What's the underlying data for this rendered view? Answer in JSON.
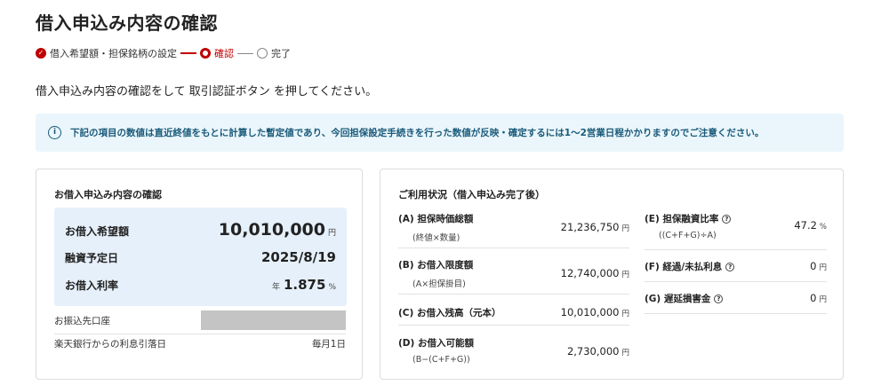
{
  "page_title": "借入申込み内容の確認",
  "steps": [
    {
      "label": "借入希望額・担保銘柄の設定",
      "state": "done"
    },
    {
      "label": "確認",
      "state": "current"
    },
    {
      "label": "完了",
      "state": "todo"
    }
  ],
  "instruction": "借入申込み内容の確認をして 取引認証ボタン を押してください。",
  "notice": {
    "icon": "info-icon",
    "text": "下記の項目の数値は直近終値をもとに計算した暫定値であり、今回担保設定手続きを行った数値が反映・確定するには1〜2営業日程かかりますのでご注意ください。"
  },
  "loan_card": {
    "title": "お借入申込み内容の確認",
    "desired_amount": {
      "label": "お借入希望額",
      "value": "10,010,000",
      "unit": "円"
    },
    "schedule_date": {
      "label": "融資予定日",
      "value": "2025/8/19"
    },
    "interest_rate": {
      "label": "お借入利率",
      "prefix": "年",
      "value": "1.875",
      "unit": "%"
    },
    "deposit_account": {
      "label": "お振込先口座"
    },
    "interest_debit": {
      "label": "楽天銀行からの利息引落日",
      "value": "毎月1日"
    }
  },
  "usage_card": {
    "title": "ご利用状況（借入申込み完了後）",
    "left_items": [
      {
        "label": "(A) 担保時価総額",
        "sub": "(終値×数量)",
        "value": "21,236,750",
        "unit": "円"
      },
      {
        "label": "(B) お借入限度額",
        "sub": "(A×担保掛目)",
        "value": "12,740,000",
        "unit": "円"
      },
      {
        "label": "(C) お借入残高（元本）",
        "sub": "",
        "value": "10,010,000",
        "unit": "円"
      },
      {
        "label": "(D) お借入可能額",
        "sub": "(B−(C+F+G))",
        "value": "2,730,000",
        "unit": "円"
      }
    ],
    "right_items": [
      {
        "label": "(E) 担保融資比率",
        "sub": "((C+F+G)÷A)",
        "value": "47.2",
        "unit": "%"
      },
      {
        "label": "(F) 経過/未払利息",
        "sub": "",
        "value": "0",
        "unit": "円"
      },
      {
        "label": "(G) 遅延損害金",
        "sub": "",
        "value": "0",
        "unit": "円"
      }
    ],
    "help_icon": "question-circle-icon"
  }
}
